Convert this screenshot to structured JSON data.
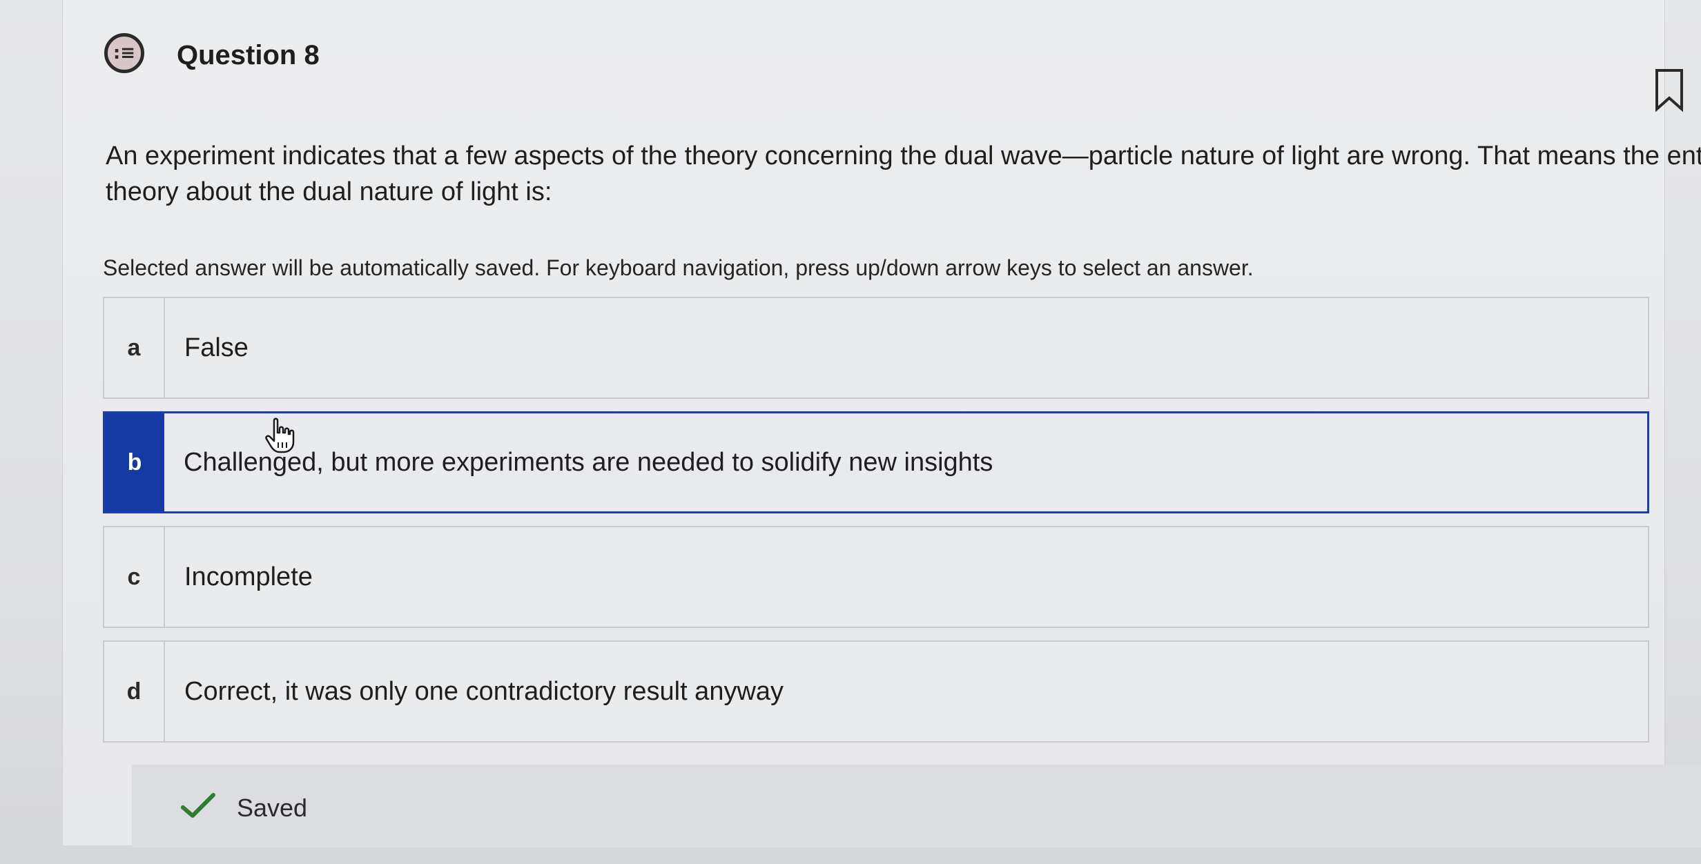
{
  "question": {
    "title": "Question 8",
    "text": "An experiment indicates that a few aspects of the theory concerning the dual wave—particle nature of light are wrong. That means the entire theory about the dual nature of light is:",
    "instructions": "Selected answer will be automatically saved. For keyboard navigation, press up/down arrow keys to select an answer.",
    "icon": "question-list-icon",
    "bookmark_icon": "bookmark-icon"
  },
  "options": [
    {
      "letter": "a",
      "text": "False",
      "selected": false
    },
    {
      "letter": "b",
      "text": "Challenged, but more experiments are needed to solidify new insights",
      "selected": true
    },
    {
      "letter": "c",
      "text": "Incomplete",
      "selected": false
    },
    {
      "letter": "d",
      "text": "Correct, it was only one contradictory result anyway",
      "selected": false
    }
  ],
  "status": {
    "saved_label": "Saved",
    "icon": "checkmark-icon"
  },
  "colors": {
    "selected_accent": "#1639a4",
    "check_green": "#2e7d32"
  }
}
